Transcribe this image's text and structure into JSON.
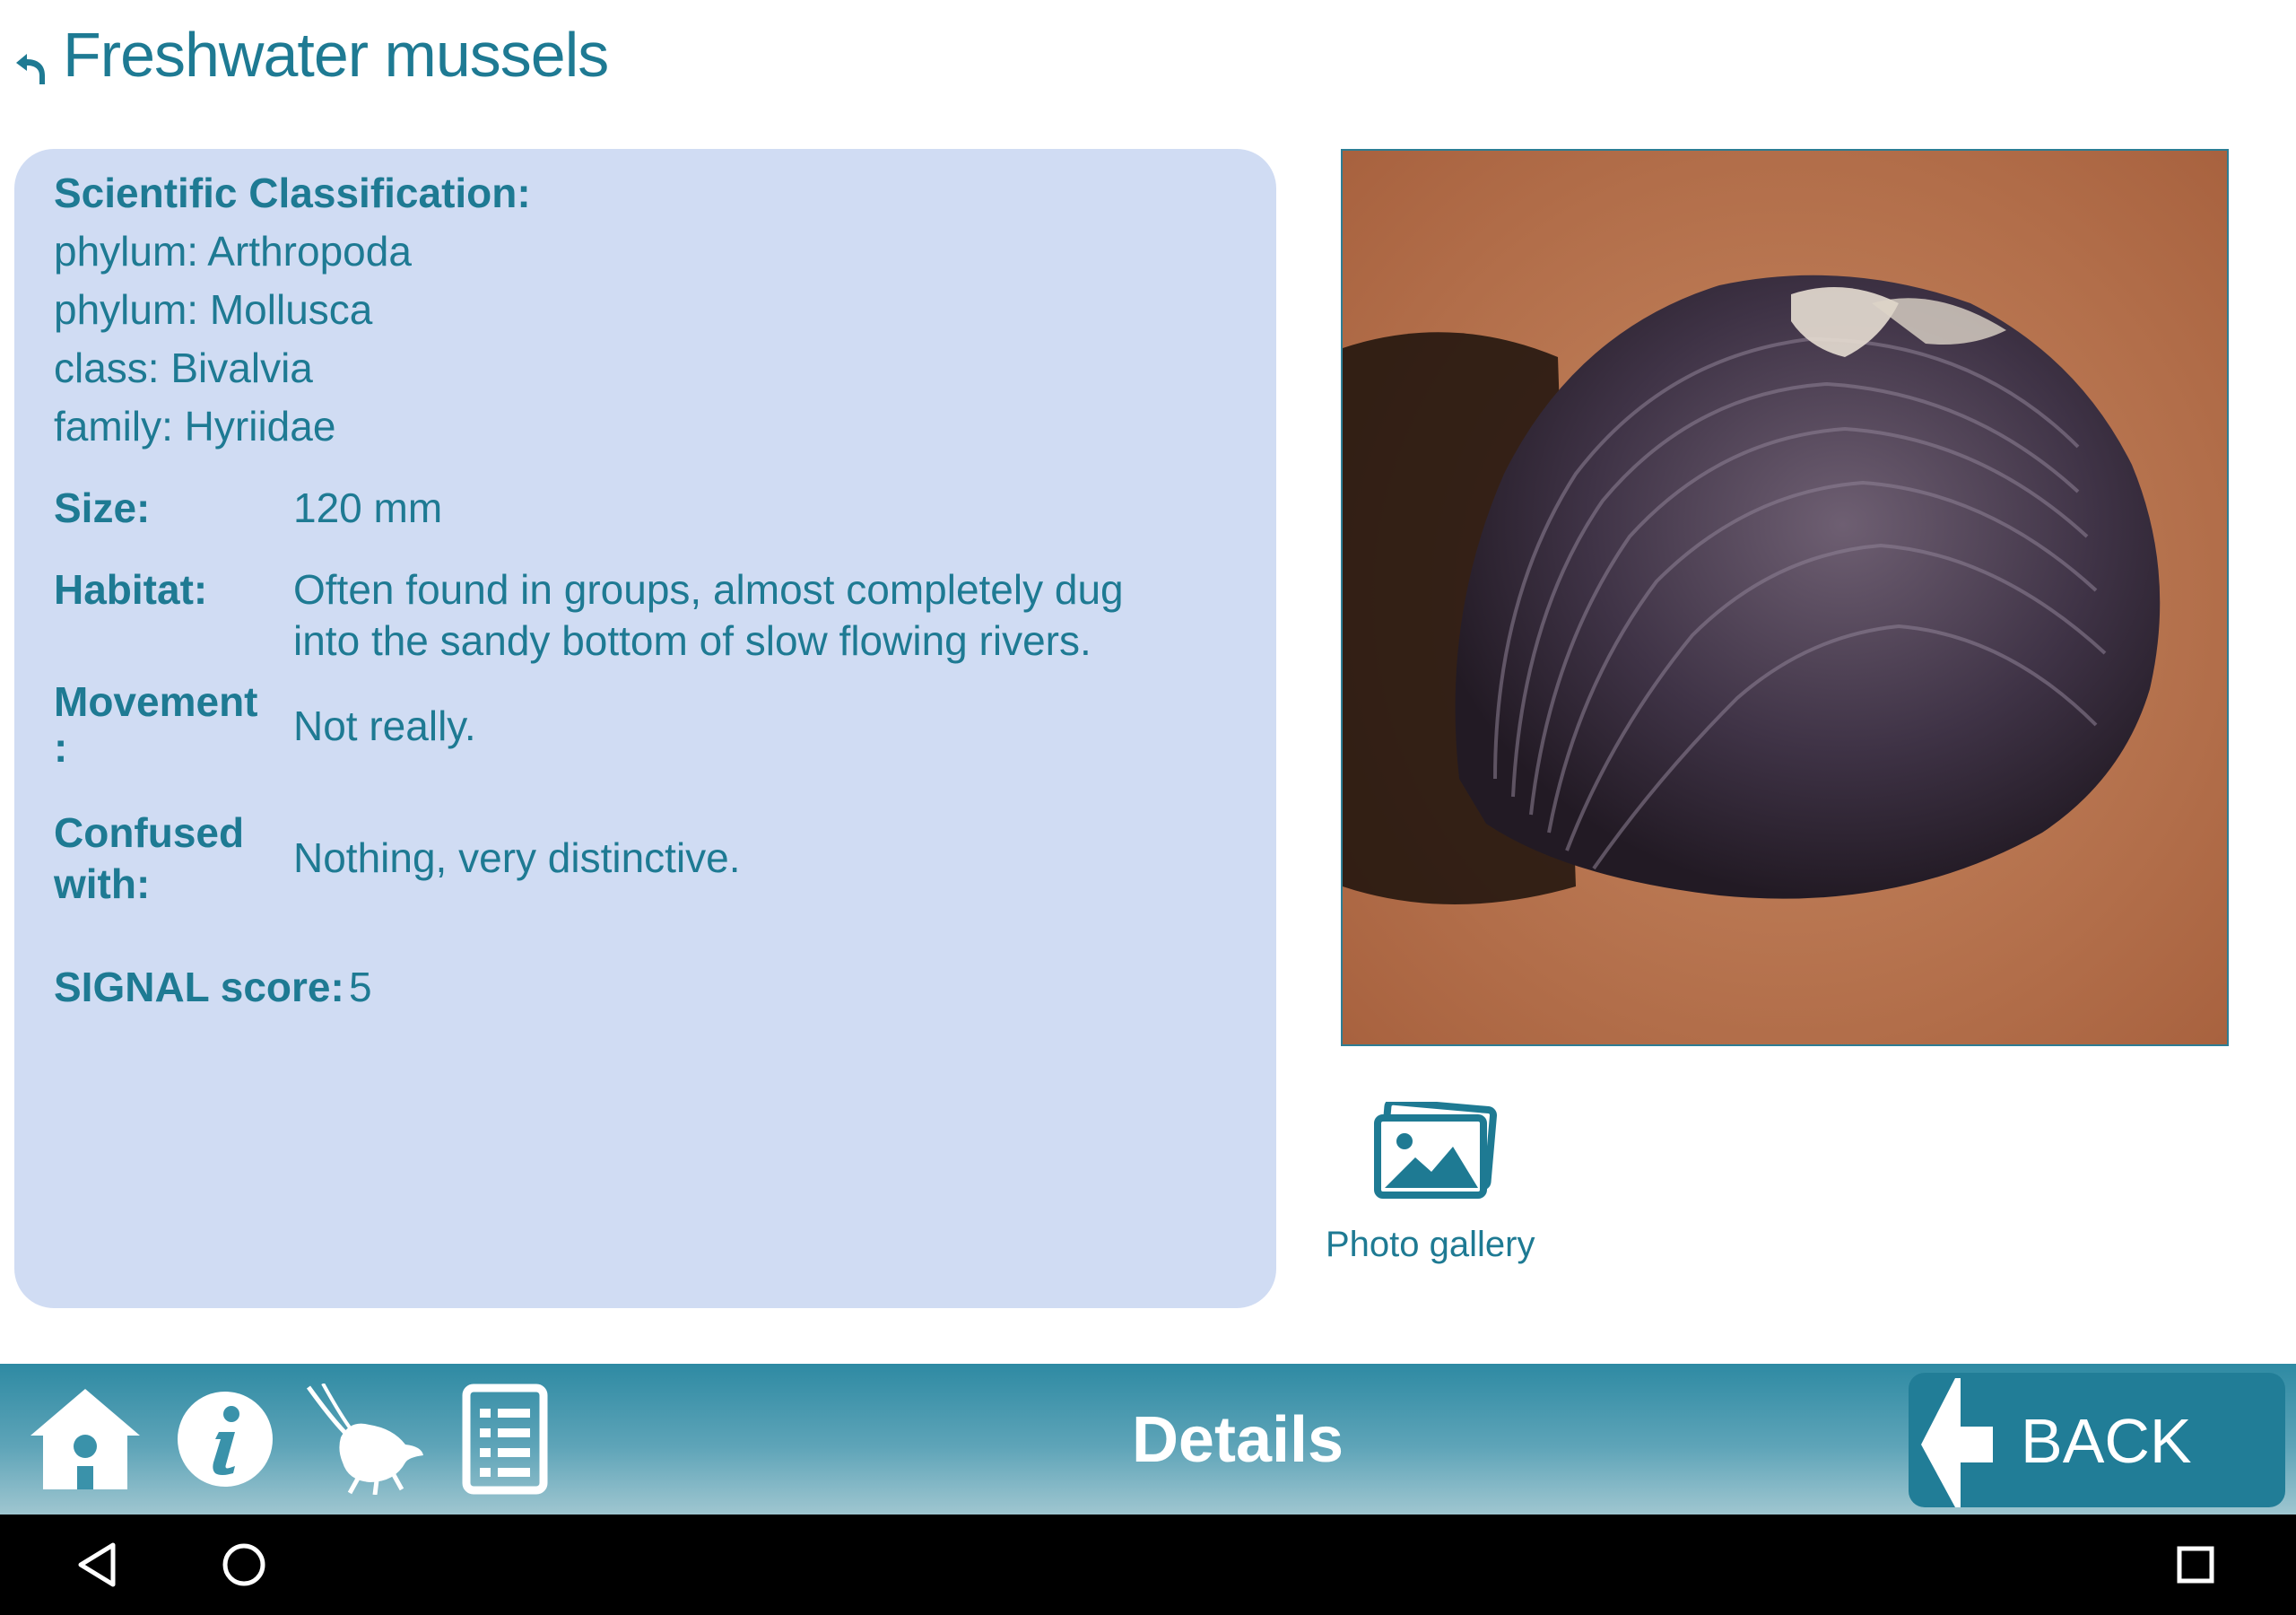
{
  "header": {
    "title": "Freshwater mussels"
  },
  "classification": {
    "heading": "Scientific Classification:",
    "lines": [
      "phylum: Arthropoda",
      "phylum: Mollusca",
      "class: Bivalvia",
      "family: Hyriidae"
    ]
  },
  "details": {
    "size_label": "Size:",
    "size_value": "120 mm",
    "habitat_label": "Habitat:",
    "habitat_line1": "Often found in groups, almost completely dug",
    "habitat_line2": "into the sandy bottom of slow flowing rivers.",
    "movement_label_1": "Movement",
    "movement_label_2": ":",
    "movement_value": "Not really.",
    "confused_label_1": "Confused",
    "confused_label_2": "with:",
    "confused_value": "Nothing, very distinctive.",
    "signal_label": "SIGNAL score:",
    "signal_value": "5"
  },
  "gallery": {
    "label": "Photo gallery"
  },
  "bottom_bar": {
    "title": "Details",
    "back_label": "BACK"
  },
  "icons": {
    "header": "back-arrow-icon",
    "nav": [
      "home-icon",
      "info-icon",
      "bug-icon",
      "list-icon"
    ],
    "photo": "magnifier-icon",
    "gallery": "photo-gallery-icon",
    "system": [
      "back-triangle-icon",
      "home-circle-icon",
      "recents-square-icon"
    ]
  },
  "colors": {
    "accent": "#1e7a93",
    "panel": "#d0dcf3",
    "button": "#217d97",
    "bar_top": "#2e8aa3",
    "bar_bottom": "#9fc6d0"
  }
}
